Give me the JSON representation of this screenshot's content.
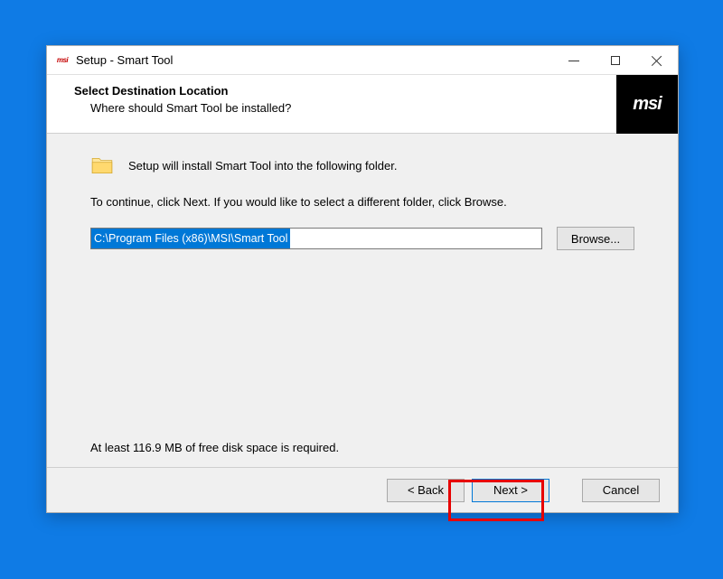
{
  "window": {
    "title": "Setup - Smart Tool",
    "brand": "msi"
  },
  "header": {
    "title": "Select Destination Location",
    "subtitle": "Where should Smart Tool be installed?"
  },
  "content": {
    "folder_label": "Setup will install Smart Tool into the following folder.",
    "instruction": "To continue, click Next. If you would like to select a different folder, click Browse.",
    "path": "C:\\Program Files (x86)\\MSI\\Smart Tool",
    "browse_label": "Browse...",
    "disk_space": "At least 116.9 MB of free disk space is required."
  },
  "buttons": {
    "back": "< Back",
    "next": "Next >",
    "cancel": "Cancel"
  }
}
